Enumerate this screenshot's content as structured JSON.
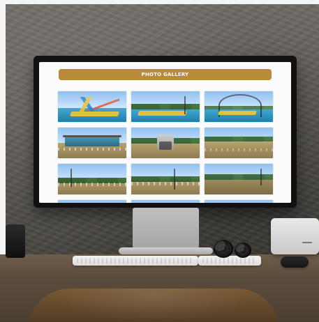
{
  "gallery": {
    "title": "PHOTO GALLERY",
    "photos": [
      {
        "kind": "waterpark-slides",
        "label": ""
      },
      {
        "kind": "pool-deck",
        "label": ""
      },
      {
        "kind": "arch-structure",
        "label": ""
      },
      {
        "kind": "park-shed",
        "label": ""
      },
      {
        "kind": "entrance-gate",
        "label": ""
      },
      {
        "kind": "garden-path",
        "label": ""
      },
      {
        "kind": "construction-site",
        "label": ""
      },
      {
        "kind": "park-outdoor",
        "label": ""
      },
      {
        "kind": "trees-open-field",
        "label": ""
      }
    ]
  },
  "colors": {
    "banner": "#b88a3a",
    "screen_bg": "#fbfbfb"
  },
  "icons": {
    "desk_items": [
      "monitor",
      "keyboard",
      "keypad",
      "mouse",
      "mini-pc",
      "pinecones",
      "speaker",
      "chair"
    ]
  }
}
